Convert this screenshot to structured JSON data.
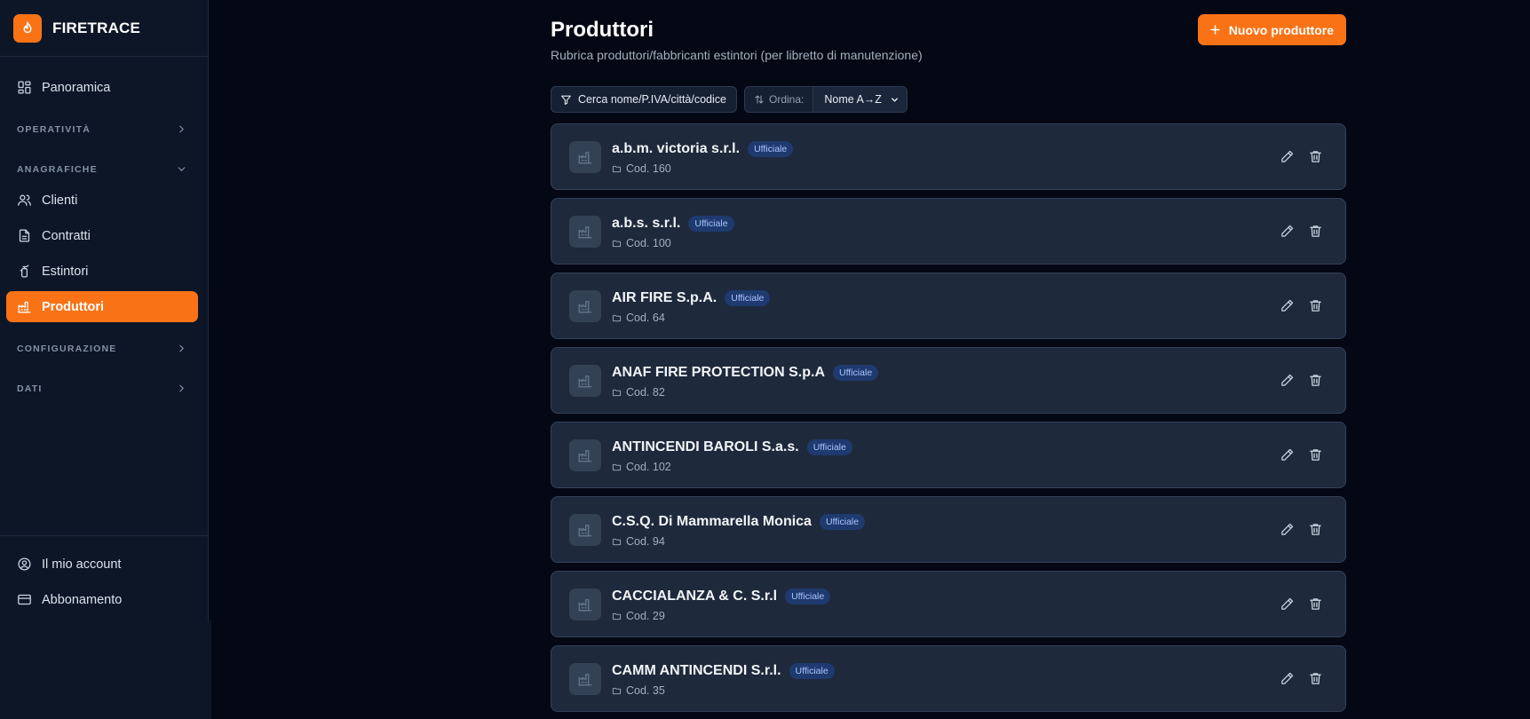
{
  "app": {
    "name": "FIRETRACE",
    "accent": "#f97316"
  },
  "sidebar": {
    "items": [
      {
        "label": "Panoramica",
        "icon": "dashboard-icon"
      },
      {
        "label": "Clienti",
        "icon": "users-icon"
      },
      {
        "label": "Contratti",
        "icon": "document-icon"
      },
      {
        "label": "Estintori",
        "icon": "extinguisher-icon"
      },
      {
        "label": "Produttori",
        "icon": "factory-icon",
        "active": true
      }
    ],
    "sections": [
      {
        "label": "OPERATIVITÀ",
        "expanded": false
      },
      {
        "label": "ANAGRAFICHE",
        "expanded": true
      },
      {
        "label": "CONFIGURAZIONE",
        "expanded": false
      },
      {
        "label": "DATI",
        "expanded": false
      }
    ],
    "footer": [
      {
        "label": "Il mio account",
        "icon": "user-circle-icon"
      },
      {
        "label": "Abbonamento",
        "icon": "credit-card-icon"
      }
    ]
  },
  "page": {
    "title": "Produttori",
    "subtitle": "Rubrica produttori/fabbricanti estintori (per libretto di manutenzione)",
    "new_button": "Nuovo produttore"
  },
  "toolbar": {
    "filter_label": "Cerca nome/P.IVA/città/codice",
    "sort_label": "Ordina:",
    "sort_value": "Nome A→Z"
  },
  "producers": [
    {
      "name": "a.b.m. victoria s.r.l.",
      "badge": "Ufficiale",
      "code": "Cod. 160"
    },
    {
      "name": "a.b.s. s.r.l.",
      "badge": "Ufficiale",
      "code": "Cod. 100"
    },
    {
      "name": "AIR FIRE S.p.A.",
      "badge": "Ufficiale",
      "code": "Cod. 64"
    },
    {
      "name": "ANAF FIRE PROTECTION S.p.A",
      "badge": "Ufficiale",
      "code": "Cod. 82"
    },
    {
      "name": "ANTINCENDI BAROLI S.a.s.",
      "badge": "Ufficiale",
      "code": "Cod. 102"
    },
    {
      "name": "C.S.Q. Di Mammarella Monica",
      "badge": "Ufficiale",
      "code": "Cod. 94"
    },
    {
      "name": "CACCIALANZA & C. S.r.l",
      "badge": "Ufficiale",
      "code": "Cod. 29"
    },
    {
      "name": "CAMM ANTINCENDI S.r.l.",
      "badge": "Ufficiale",
      "code": "Cod. 35"
    }
  ]
}
